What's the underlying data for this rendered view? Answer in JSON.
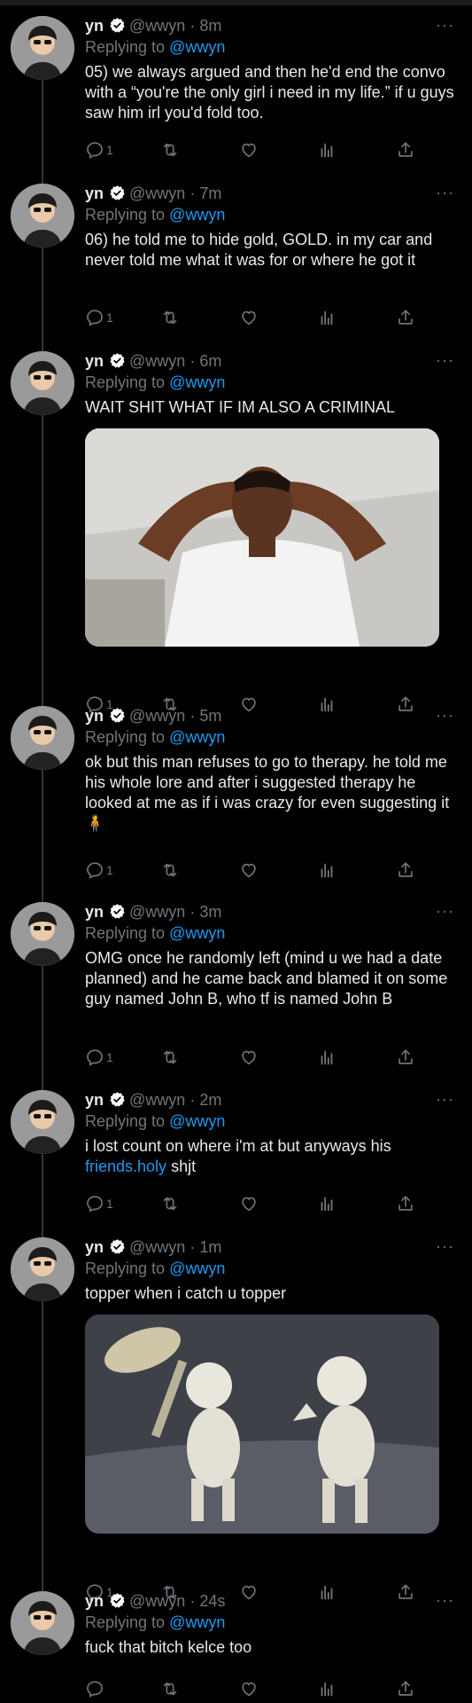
{
  "reply_prefix": "Replying to",
  "more_glyph": "···",
  "colors": {
    "background": "#000000",
    "link": "#1d9bf0",
    "muted": "#71767b",
    "text": "#e7e9ea"
  },
  "tweets": [
    {
      "name": "yn",
      "handle": "@wwyn",
      "sep": "·",
      "time": "8m",
      "replying_to": "@wwyn",
      "text": "05) we always argued and then he'd end the convo with a “you're the only girl i need in my life.” if u guys saw him irl you'd fold too.",
      "reply_count": "1"
    },
    {
      "name": "yn",
      "handle": "@wwyn",
      "sep": "·",
      "time": "7m",
      "replying_to": "@wwyn",
      "text": "06) he told me to hide gold, GOLD. in my car and never told me what it was for or where he got it",
      "reply_count": "1"
    },
    {
      "name": "yn",
      "handle": "@wwyn",
      "sep": "·",
      "time": "6m",
      "replying_to": "@wwyn",
      "text": "WAIT SHIT WHAT IF IM ALSO A CRIMINAL",
      "reply_count": "1"
    },
    {
      "name": "yn",
      "handle": "@wwyn",
      "sep": "·",
      "time": "5m",
      "replying_to": "@wwyn",
      "text": "ok but this man refuses to go to therapy. he told me his whole lore and after i suggested therapy he looked at me as if i was crazy for even suggesting it 🧍",
      "reply_count": "1"
    },
    {
      "name": "yn",
      "handle": "@wwyn",
      "sep": "·",
      "time": "3m",
      "replying_to": "@wwyn",
      "text": "OMG once he randomly left (mind u we had a date planned) and he came back and blamed it on some guy named John B, who tf is named John B",
      "reply_count": "1"
    },
    {
      "name": "yn",
      "handle": "@wwyn",
      "sep": "·",
      "time": "2m",
      "replying_to": "@wwyn",
      "text_before": "i lost count on where i'm at but anyways his ",
      "text_link": "friends.holy",
      "text_after": " shjt",
      "reply_count": "1"
    },
    {
      "name": "yn",
      "handle": "@wwyn",
      "sep": "·",
      "time": "1m",
      "replying_to": "@wwyn",
      "text": "topper when i catch u topper",
      "reply_count": "1"
    },
    {
      "name": "yn",
      "handle": "@wwyn",
      "sep": "·",
      "time": "24s",
      "replying_to": "@wwyn",
      "text": "fuck that bitch kelce too",
      "reply_count": ""
    }
  ]
}
